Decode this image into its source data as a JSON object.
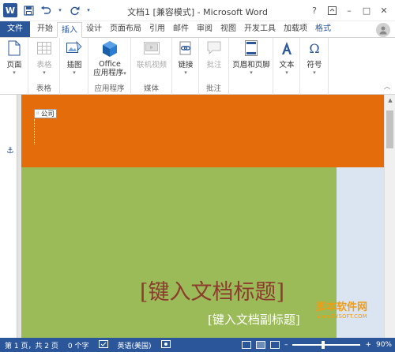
{
  "titlebar": {
    "app_icon_letter": "W",
    "title": "文档1 [兼容模式] - Microsoft Word",
    "help": "?",
    "minimize": "–",
    "restore": "□",
    "close": "✕"
  },
  "tabs": [
    {
      "label": "文件"
    },
    {
      "label": "开始"
    },
    {
      "label": "插入"
    },
    {
      "label": "设计"
    },
    {
      "label": "页面布局"
    },
    {
      "label": "引用"
    },
    {
      "label": "邮件"
    },
    {
      "label": "审阅"
    },
    {
      "label": "视图"
    },
    {
      "label": "开发工具"
    },
    {
      "label": "加载项"
    },
    {
      "label": "格式"
    }
  ],
  "ribbon": {
    "groups": [
      {
        "label": ""
      },
      {
        "label": "表格"
      },
      {
        "label": ""
      },
      {
        "label": "应用程序"
      },
      {
        "label": "媒体"
      },
      {
        "label": ""
      },
      {
        "label": "批注"
      },
      {
        "label": ""
      },
      {
        "label": ""
      },
      {
        "label": ""
      }
    ],
    "buttons": {
      "pages": "页面",
      "table": "表格",
      "illustrations": "插图",
      "office_line1": "Office",
      "office_line2": "应用程序",
      "online_video": "联机视频",
      "links": "链接",
      "comment": "批注",
      "header_footer": "页眉和页脚",
      "text": "文本",
      "symbols": "符号"
    },
    "icons": {
      "pages": "page-icon",
      "table": "table-icon",
      "illustrations": "picture-icon",
      "office": "office-icon",
      "online_video": "video-icon",
      "links": "link-icon",
      "comment": "comment-icon",
      "header_footer": "header-footer-icon",
      "text": "text-box-icon",
      "symbols": "omega-icon"
    }
  },
  "document": {
    "company_tag": "公司",
    "title_placeholder": "[键入文档标题]",
    "subtitle_placeholder": "[键入文档副标题]",
    "colors": {
      "orange_band": "#e46c0a",
      "green_block": "#9bbb59",
      "blue_strip": "#dbe5f1",
      "title_text": "#8c3b2e"
    }
  },
  "watermark": {
    "main": "脚本软件网",
    "url": "www.DYSOFT.COM"
  },
  "statusbar": {
    "page": "第 1 页，共 2 页",
    "words": "0 个字",
    "language": "英语(美国)",
    "zoom_minus": "–",
    "zoom_plus": "+",
    "zoom": "90%",
    "zoom_level": 0.9
  },
  "accent_color": "#2b579a"
}
